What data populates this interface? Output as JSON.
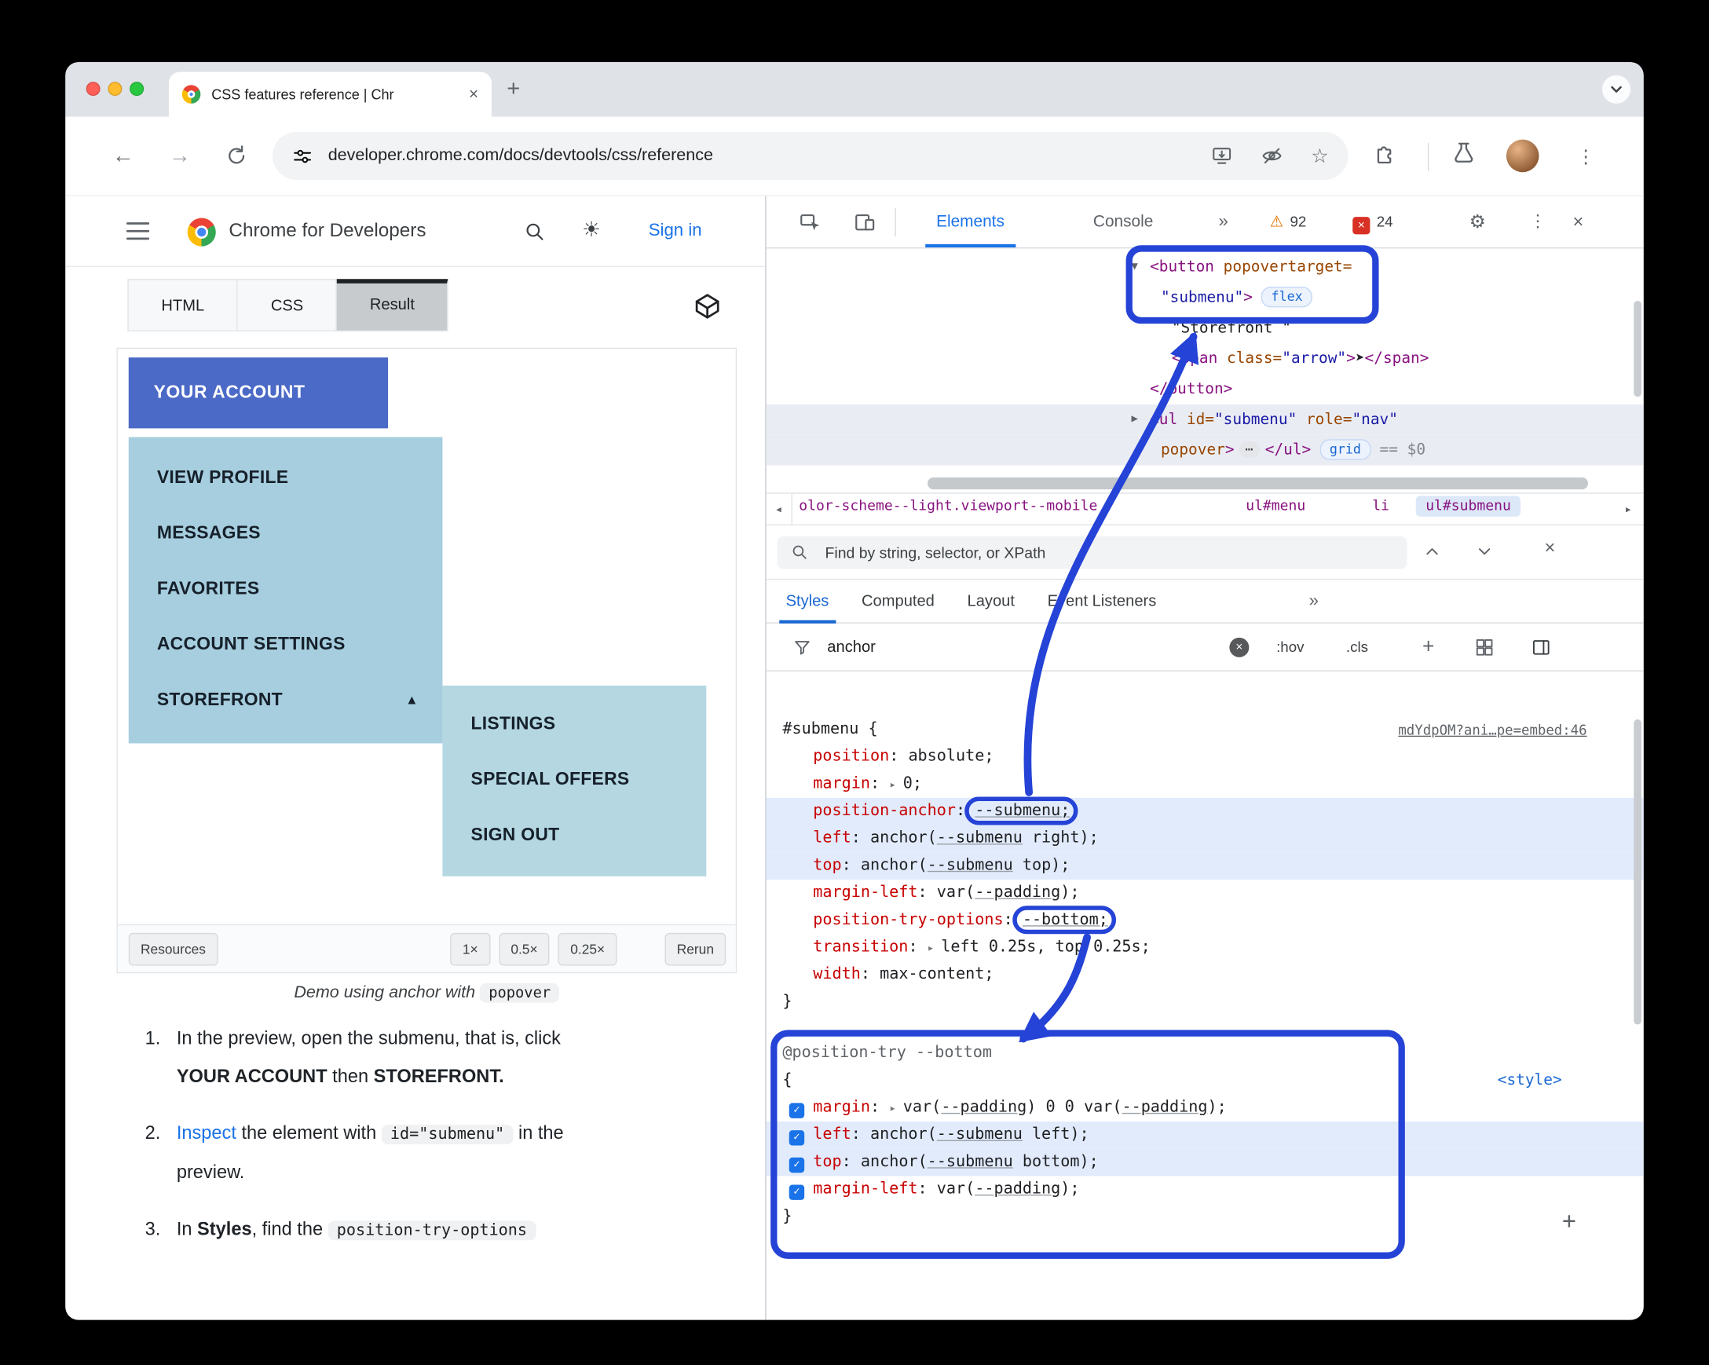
{
  "window": {
    "tab_title": "CSS features reference  |  Chr",
    "url": "developer.chrome.com/docs/devtools/css/reference"
  },
  "icons": {
    "close": "×",
    "plus": "+",
    "more": "»",
    "kebab": "⋮",
    "gear": "⚙",
    "warn": "⚠",
    "sun": "☀",
    "star": "☆",
    "left": "◂",
    "right": "▸",
    "check": "✓",
    "back": "←",
    "forward": "→"
  },
  "colors": {
    "annotation_blue": "#2543d6",
    "link_blue": "#1a73e8",
    "account_button_blue": "#4b69c6",
    "submenu_bg": "#a6cede",
    "subsubmenu_bg": "#b4d7e2",
    "highlight_row": "#e1ebfc",
    "warning_orange": "#e37400",
    "error_red": "#d93025"
  },
  "site": {
    "brand": "Chrome for Developers",
    "sign_in": "Sign in",
    "demo_tabs": [
      "HTML",
      "CSS",
      "Result"
    ],
    "menu_button": "YOUR ACCOUNT",
    "submenu_items": [
      "VIEW PROFILE",
      "MESSAGES",
      "FAVORITES",
      "ACCOUNT SETTINGS",
      "STOREFRONT"
    ],
    "storefront_arrow": "▲",
    "subsubmenu_items": [
      "LISTINGS",
      "SPECIAL OFFERS",
      "SIGN OUT"
    ],
    "footer": {
      "resources": "Resources",
      "scales": [
        "1×",
        "0.5×",
        "0.25×"
      ],
      "rerun": "Rerun"
    },
    "caption": [
      [
        "Demo using anchor with ",
        "i"
      ],
      [
        "popover",
        "code"
      ]
    ],
    "steps": [
      [
        [
          "In the preview, open the submenu, that is, click",
          ""
        ],
        [
          "br"
        ],
        [
          "YOUR ACCOUNT",
          "b"
        ],
        [
          " then ",
          ""
        ],
        [
          "STOREFRONT.",
          "b"
        ]
      ],
      [
        [
          "Inspect",
          "link"
        ],
        [
          " the element with ",
          ""
        ],
        [
          "id=\"submenu\"",
          "code"
        ],
        [
          " in the",
          ""
        ],
        [
          "br"
        ],
        [
          "preview.",
          ""
        ]
      ],
      [
        [
          "In ",
          ""
        ],
        [
          "Styles",
          "b"
        ],
        [
          ", find the ",
          ""
        ],
        [
          "position-try-options",
          "code"
        ]
      ]
    ]
  },
  "devtools": {
    "tabs": [
      "Elements",
      "Console"
    ],
    "warn_count": "92",
    "error_count": "24",
    "tree": [
      {
        "caret": "▼",
        "parts": [
          [
            "<button ",
            "tag"
          ],
          [
            "popovertarget=",
            "attr"
          ]
        ]
      },
      {
        "parts": [
          [
            "\"submenu\"",
            "val"
          ],
          [
            ">",
            "tag"
          ],
          [
            "flex",
            "badge"
          ]
        ]
      },
      {
        "parts": [
          [
            "\"Storefront \"",
            "text"
          ]
        ]
      },
      {
        "parts": [
          [
            "<span",
            "tag"
          ],
          [
            " class=",
            "attr"
          ],
          [
            "\"arrow\"",
            "val"
          ],
          [
            ">",
            "tag"
          ],
          [
            "➤",
            "text"
          ],
          [
            "</span>",
            "tag"
          ]
        ]
      },
      {
        "parts": [
          [
            "</button>",
            "tag"
          ]
        ]
      },
      {
        "caret": "▶",
        "sel": true,
        "parts": [
          [
            "<ul",
            "tag"
          ],
          [
            " id=",
            "attr"
          ],
          [
            "\"submenu\"",
            "val"
          ],
          [
            " role=",
            "attr"
          ],
          [
            "\"nav\"",
            "val"
          ]
        ]
      },
      {
        "sel": true,
        "parts": [
          [
            "popover",
            "attr"
          ],
          [
            ">",
            "tag"
          ],
          [
            "⋯",
            "dots"
          ],
          [
            "</ul>",
            "tag"
          ],
          [
            "grid",
            "badge"
          ],
          [
            "== $0",
            "eq"
          ]
        ]
      }
    ],
    "crumbs": [
      {
        "t": "olor-scheme--light.viewport--mobile"
      },
      {
        "t": "ul#menu"
      },
      {
        "t": "li"
      },
      {
        "t": "ul#submenu",
        "sel": true
      }
    ],
    "find_placeholder": "Find by string, selector, or XPath",
    "sidebar_tabs": [
      "Styles",
      "Computed",
      "Layout",
      "Event Listeners"
    ],
    "filter_text": "anchor",
    "hov": ":hov",
    "cls": ".cls",
    "style_rows": [
      {
        "parts": [
          [
            "#submenu {",
            "sel"
          ]
        ],
        "link": {
          "t": "mdYdpOM?ani…pe=embed:46",
          "cls": "gray"
        }
      },
      {
        "ind": true,
        "parts": [
          [
            "position",
            "prop"
          ],
          [
            ": ",
            "pun"
          ],
          [
            "absolute",
            "val"
          ],
          [
            ";",
            "pun"
          ]
        ]
      },
      {
        "ind": true,
        "parts": [
          [
            "margin",
            "prop"
          ],
          [
            ": ",
            "pun"
          ],
          [
            "▸ ",
            "exp"
          ],
          [
            "0",
            "val"
          ],
          [
            ";",
            "pun"
          ]
        ]
      },
      {
        "ind": true,
        "hl": true,
        "parts": [
          [
            "position-anchor",
            "prop"
          ],
          [
            ": ",
            "pun"
          ],
          [
            "--submenu;",
            "val u",
            "oval-submenu"
          ]
        ]
      },
      {
        "ind": true,
        "hl": true,
        "parts": [
          [
            "left",
            "prop"
          ],
          [
            ": ",
            "pun"
          ],
          [
            "anchor(",
            "val"
          ],
          [
            "--submenu",
            "val u"
          ],
          [
            " right)",
            "val"
          ],
          [
            ";",
            "pun"
          ]
        ]
      },
      {
        "ind": true,
        "hl": true,
        "parts": [
          [
            "top",
            "prop"
          ],
          [
            ": ",
            "pun"
          ],
          [
            "anchor(",
            "val"
          ],
          [
            "--submenu",
            "val u"
          ],
          [
            " top)",
            "val"
          ],
          [
            ";",
            "pun"
          ]
        ]
      },
      {
        "ind": true,
        "parts": [
          [
            "margin-left",
            "prop"
          ],
          [
            ": ",
            "pun"
          ],
          [
            "var(",
            "val"
          ],
          [
            "--padding",
            "val u"
          ],
          [
            ")",
            "val"
          ],
          [
            ";",
            "pun"
          ]
        ]
      },
      {
        "ind": true,
        "parts": [
          [
            "position-try-options",
            "prop"
          ],
          [
            ": ",
            "pun"
          ],
          [
            "--bottom;",
            "val u",
            "oval-bottom"
          ]
        ]
      },
      {
        "ind": true,
        "parts": [
          [
            "transition",
            "prop"
          ],
          [
            ": ",
            "pun"
          ],
          [
            "▸ ",
            "exp"
          ],
          [
            "left 0.25s, top 0.25s",
            "val"
          ],
          [
            ";",
            "pun"
          ]
        ]
      },
      {
        "ind": true,
        "parts": [
          [
            "width",
            "prop"
          ],
          [
            ": ",
            "pun"
          ],
          [
            "max-content",
            "val"
          ],
          [
            ";",
            "pun"
          ]
        ]
      },
      {
        "parts": [
          [
            "}",
            "sel"
          ]
        ]
      },
      {
        "gap": true,
        "parts": [
          [
            "@position-try --bottom",
            "at"
          ]
        ]
      },
      {
        "parts": [
          [
            "{",
            "sel"
          ]
        ],
        "link": {
          "t": "<style>",
          "cls": "blue"
        }
      },
      {
        "ind": true,
        "cb": true,
        "parts": [
          [
            "margin",
            "prop"
          ],
          [
            ": ",
            "pun"
          ],
          [
            "▸ ",
            "exp"
          ],
          [
            "var(",
            "val"
          ],
          [
            "--padding",
            "val u"
          ],
          [
            ") 0 0 var(",
            "val"
          ],
          [
            "--padding",
            "val u"
          ],
          [
            ")",
            "val"
          ],
          [
            ";",
            "pun"
          ]
        ]
      },
      {
        "ind": true,
        "cb": true,
        "hl": true,
        "parts": [
          [
            "left",
            "prop"
          ],
          [
            ": ",
            "pun"
          ],
          [
            "anchor(",
            "val"
          ],
          [
            "--submenu",
            "val u"
          ],
          [
            " left)",
            "val"
          ],
          [
            ";",
            "pun"
          ]
        ]
      },
      {
        "ind": true,
        "cb": true,
        "hl": true,
        "parts": [
          [
            "top",
            "prop"
          ],
          [
            ": ",
            "pun"
          ],
          [
            "anchor(",
            "val"
          ],
          [
            "--submenu",
            "val u"
          ],
          [
            " bottom)",
            "val"
          ],
          [
            ";",
            "pun"
          ]
        ]
      },
      {
        "ind": true,
        "cb": true,
        "parts": [
          [
            "margin-left",
            "prop"
          ],
          [
            ": ",
            "pun"
          ],
          [
            "var(",
            "val"
          ],
          [
            "--padding",
            "val u"
          ],
          [
            ")",
            "val"
          ],
          [
            ";",
            "pun"
          ]
        ]
      },
      {
        "parts": [
          [
            "}",
            "sel"
          ]
        ]
      }
    ]
  }
}
